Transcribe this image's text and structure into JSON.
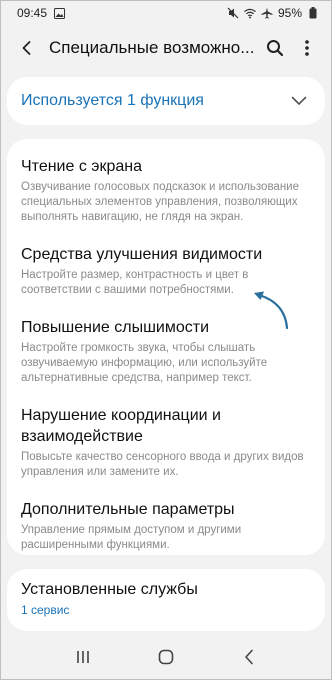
{
  "status_bar": {
    "time": "09:45",
    "battery": "95%",
    "icons": [
      "image-icon",
      "mute-icon",
      "wifi-icon",
      "airplane-icon",
      "battery-icon"
    ]
  },
  "appbar": {
    "title": "Специальные возможно..."
  },
  "functions_card": {
    "label": "Используется 1 функция"
  },
  "items": [
    {
      "title": "Чтение с экрана",
      "desc": "Озвучивание голосовых подсказок и использование специальных элементов управления, позволяющих выполнять навигацию, не глядя на экран."
    },
    {
      "title": "Средства улучшения видимости",
      "desc": "Настройте размер, контрастность и цвет в соответствии с вашими потребностями."
    },
    {
      "title": "Повышение слышимости",
      "desc": "Настройте громкость звука, чтобы слышать озвучиваемую информацию, или используйте альтернативные средства, например текст."
    },
    {
      "title": "Нарушение координации и взаимодействие",
      "desc": "Повысьте качество сенсорного ввода и других видов управления или замените их."
    },
    {
      "title": "Дополнительные параметры",
      "desc": "Управление прямым доступом и другими расширенными функциями."
    }
  ],
  "services_card": {
    "title": "Установленные службы",
    "sub": "1 сервис"
  },
  "colors": {
    "accent": "#1a73b8",
    "background": "#f2f2f2",
    "card": "#ffffff",
    "secondary_text": "#8a8a8a",
    "arrow": "#2a6f9e"
  }
}
